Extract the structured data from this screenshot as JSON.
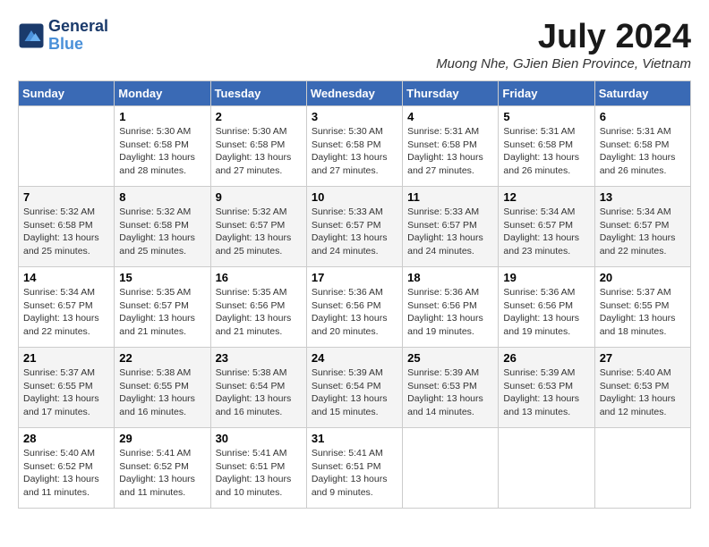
{
  "header": {
    "logo_line1": "General",
    "logo_line2": "Blue",
    "month_title": "July 2024",
    "location": "Muong Nhe, GJien Bien Province, Vietnam"
  },
  "weekdays": [
    "Sunday",
    "Monday",
    "Tuesday",
    "Wednesday",
    "Thursday",
    "Friday",
    "Saturday"
  ],
  "weeks": [
    [
      {
        "day": "",
        "sunrise": "",
        "sunset": "",
        "daylight": ""
      },
      {
        "day": "1",
        "sunrise": "Sunrise: 5:30 AM",
        "sunset": "Sunset: 6:58 PM",
        "daylight": "Daylight: 13 hours and 28 minutes."
      },
      {
        "day": "2",
        "sunrise": "Sunrise: 5:30 AM",
        "sunset": "Sunset: 6:58 PM",
        "daylight": "Daylight: 13 hours and 27 minutes."
      },
      {
        "day": "3",
        "sunrise": "Sunrise: 5:30 AM",
        "sunset": "Sunset: 6:58 PM",
        "daylight": "Daylight: 13 hours and 27 minutes."
      },
      {
        "day": "4",
        "sunrise": "Sunrise: 5:31 AM",
        "sunset": "Sunset: 6:58 PM",
        "daylight": "Daylight: 13 hours and 27 minutes."
      },
      {
        "day": "5",
        "sunrise": "Sunrise: 5:31 AM",
        "sunset": "Sunset: 6:58 PM",
        "daylight": "Daylight: 13 hours and 26 minutes."
      },
      {
        "day": "6",
        "sunrise": "Sunrise: 5:31 AM",
        "sunset": "Sunset: 6:58 PM",
        "daylight": "Daylight: 13 hours and 26 minutes."
      }
    ],
    [
      {
        "day": "7",
        "sunrise": "Sunrise: 5:32 AM",
        "sunset": "Sunset: 6:58 PM",
        "daylight": "Daylight: 13 hours and 25 minutes."
      },
      {
        "day": "8",
        "sunrise": "Sunrise: 5:32 AM",
        "sunset": "Sunset: 6:58 PM",
        "daylight": "Daylight: 13 hours and 25 minutes."
      },
      {
        "day": "9",
        "sunrise": "Sunrise: 5:32 AM",
        "sunset": "Sunset: 6:57 PM",
        "daylight": "Daylight: 13 hours and 25 minutes."
      },
      {
        "day": "10",
        "sunrise": "Sunrise: 5:33 AM",
        "sunset": "Sunset: 6:57 PM",
        "daylight": "Daylight: 13 hours and 24 minutes."
      },
      {
        "day": "11",
        "sunrise": "Sunrise: 5:33 AM",
        "sunset": "Sunset: 6:57 PM",
        "daylight": "Daylight: 13 hours and 24 minutes."
      },
      {
        "day": "12",
        "sunrise": "Sunrise: 5:34 AM",
        "sunset": "Sunset: 6:57 PM",
        "daylight": "Daylight: 13 hours and 23 minutes."
      },
      {
        "day": "13",
        "sunrise": "Sunrise: 5:34 AM",
        "sunset": "Sunset: 6:57 PM",
        "daylight": "Daylight: 13 hours and 22 minutes."
      }
    ],
    [
      {
        "day": "14",
        "sunrise": "Sunrise: 5:34 AM",
        "sunset": "Sunset: 6:57 PM",
        "daylight": "Daylight: 13 hours and 22 minutes."
      },
      {
        "day": "15",
        "sunrise": "Sunrise: 5:35 AM",
        "sunset": "Sunset: 6:57 PM",
        "daylight": "Daylight: 13 hours and 21 minutes."
      },
      {
        "day": "16",
        "sunrise": "Sunrise: 5:35 AM",
        "sunset": "Sunset: 6:56 PM",
        "daylight": "Daylight: 13 hours and 21 minutes."
      },
      {
        "day": "17",
        "sunrise": "Sunrise: 5:36 AM",
        "sunset": "Sunset: 6:56 PM",
        "daylight": "Daylight: 13 hours and 20 minutes."
      },
      {
        "day": "18",
        "sunrise": "Sunrise: 5:36 AM",
        "sunset": "Sunset: 6:56 PM",
        "daylight": "Daylight: 13 hours and 19 minutes."
      },
      {
        "day": "19",
        "sunrise": "Sunrise: 5:36 AM",
        "sunset": "Sunset: 6:56 PM",
        "daylight": "Daylight: 13 hours and 19 minutes."
      },
      {
        "day": "20",
        "sunrise": "Sunrise: 5:37 AM",
        "sunset": "Sunset: 6:55 PM",
        "daylight": "Daylight: 13 hours and 18 minutes."
      }
    ],
    [
      {
        "day": "21",
        "sunrise": "Sunrise: 5:37 AM",
        "sunset": "Sunset: 6:55 PM",
        "daylight": "Daylight: 13 hours and 17 minutes."
      },
      {
        "day": "22",
        "sunrise": "Sunrise: 5:38 AM",
        "sunset": "Sunset: 6:55 PM",
        "daylight": "Daylight: 13 hours and 16 minutes."
      },
      {
        "day": "23",
        "sunrise": "Sunrise: 5:38 AM",
        "sunset": "Sunset: 6:54 PM",
        "daylight": "Daylight: 13 hours and 16 minutes."
      },
      {
        "day": "24",
        "sunrise": "Sunrise: 5:39 AM",
        "sunset": "Sunset: 6:54 PM",
        "daylight": "Daylight: 13 hours and 15 minutes."
      },
      {
        "day": "25",
        "sunrise": "Sunrise: 5:39 AM",
        "sunset": "Sunset: 6:53 PM",
        "daylight": "Daylight: 13 hours and 14 minutes."
      },
      {
        "day": "26",
        "sunrise": "Sunrise: 5:39 AM",
        "sunset": "Sunset: 6:53 PM",
        "daylight": "Daylight: 13 hours and 13 minutes."
      },
      {
        "day": "27",
        "sunrise": "Sunrise: 5:40 AM",
        "sunset": "Sunset: 6:53 PM",
        "daylight": "Daylight: 13 hours and 12 minutes."
      }
    ],
    [
      {
        "day": "28",
        "sunrise": "Sunrise: 5:40 AM",
        "sunset": "Sunset: 6:52 PM",
        "daylight": "Daylight: 13 hours and 11 minutes."
      },
      {
        "day": "29",
        "sunrise": "Sunrise: 5:41 AM",
        "sunset": "Sunset: 6:52 PM",
        "daylight": "Daylight: 13 hours and 11 minutes."
      },
      {
        "day": "30",
        "sunrise": "Sunrise: 5:41 AM",
        "sunset": "Sunset: 6:51 PM",
        "daylight": "Daylight: 13 hours and 10 minutes."
      },
      {
        "day": "31",
        "sunrise": "Sunrise: 5:41 AM",
        "sunset": "Sunset: 6:51 PM",
        "daylight": "Daylight: 13 hours and 9 minutes."
      },
      {
        "day": "",
        "sunrise": "",
        "sunset": "",
        "daylight": ""
      },
      {
        "day": "",
        "sunrise": "",
        "sunset": "",
        "daylight": ""
      },
      {
        "day": "",
        "sunrise": "",
        "sunset": "",
        "daylight": ""
      }
    ]
  ]
}
